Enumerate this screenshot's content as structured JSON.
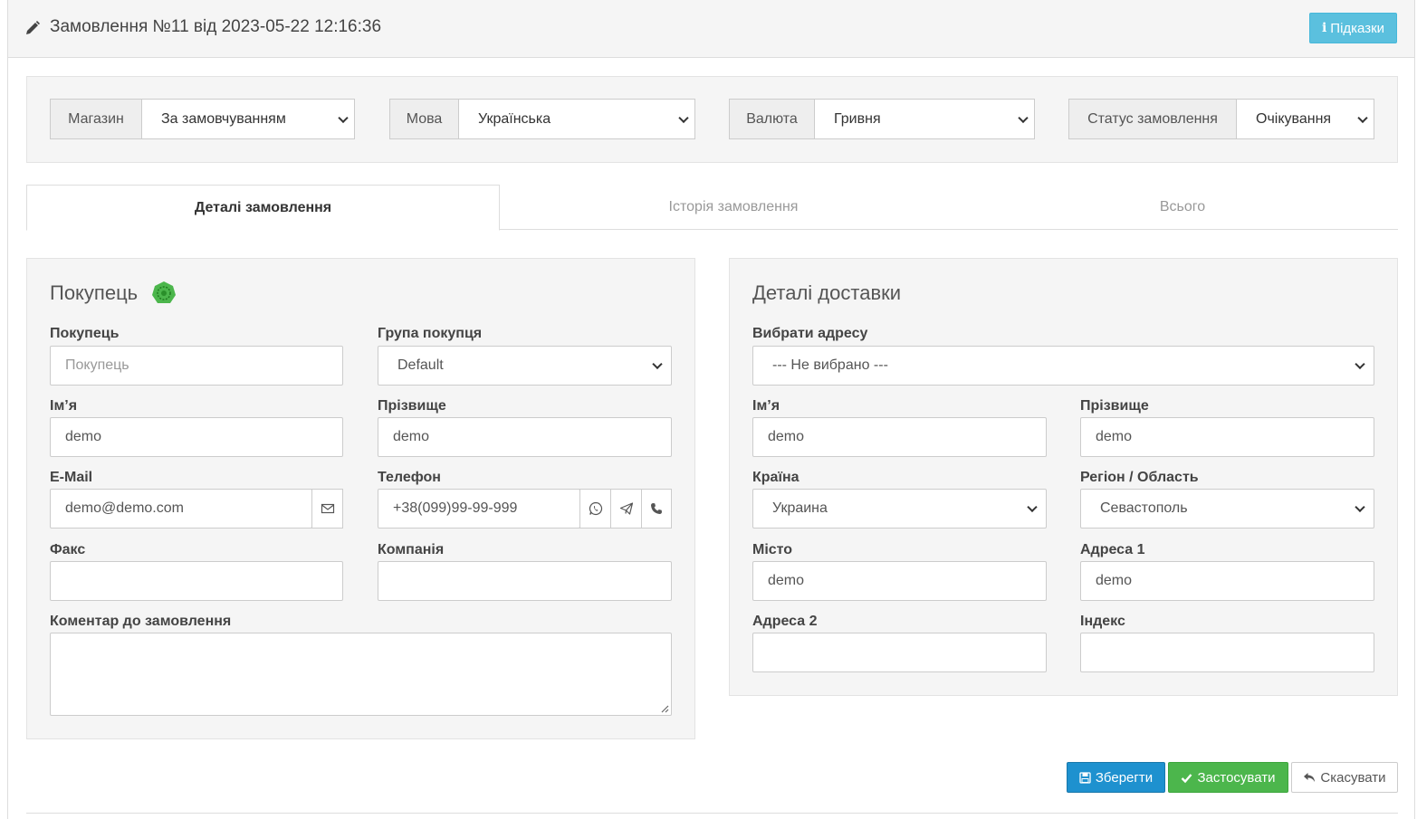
{
  "header": {
    "title": "Замовлення №11 від 2023-05-22 12:16:36",
    "hints_label": "Підказки",
    "colors": {
      "info": "#5bc0de"
    }
  },
  "filters": {
    "store": {
      "label": "Магазин",
      "value": "За замовчуванням"
    },
    "language": {
      "label": "Мова",
      "value": "Українська"
    },
    "currency": {
      "label": "Валюта",
      "value": "Гривня"
    },
    "status": {
      "label": "Статус замовлення",
      "value": "Очікування"
    }
  },
  "tabs": [
    {
      "label": "Деталі замовлення",
      "active": true
    },
    {
      "label": "Історія замовлення",
      "active": false
    },
    {
      "label": "Всього",
      "active": false
    }
  ],
  "customer": {
    "legend": "Покупець",
    "customer_label": "Покупець",
    "customer_placeholder": "Покупець",
    "group_label": "Група покупця",
    "group_value": "Default",
    "firstname_label": "Ім’я",
    "firstname_value": "demo",
    "lastname_label": "Прізвище",
    "lastname_value": "demo",
    "email_label": "E-Mail",
    "email_value": "demo@demo.com",
    "phone_label": "Телефон",
    "phone_value": "+38(099)99-99-999",
    "fax_label": "Факс",
    "fax_value": "",
    "company_label": "Компанія",
    "company_value": "",
    "comment_label": "Коментар до замовлення",
    "comment_value": ""
  },
  "shipping": {
    "legend": "Деталі доставки",
    "address_label": "Вибрати адресу",
    "address_value": "--- Не вибрано ---",
    "firstname_label": "Ім’я",
    "firstname_value": "demo",
    "lastname_label": "Прізвище",
    "lastname_value": "demo",
    "country_label": "Країна",
    "country_value": "Украина",
    "region_label": "Регіон / Область",
    "region_value": "Севастополь",
    "city_label": "Місто",
    "city_value": "demo",
    "address1_label": "Адреса 1",
    "address1_value": "demo",
    "address2_label": "Адреса 2",
    "address2_value": "",
    "postcode_label": "Індекс",
    "postcode_value": ""
  },
  "actions": {
    "save": "Зберегти",
    "apply": "Застосувати",
    "cancel": "Скасувати",
    "colors": {
      "primary": "#1e91cf",
      "success": "#4cb64c"
    }
  }
}
